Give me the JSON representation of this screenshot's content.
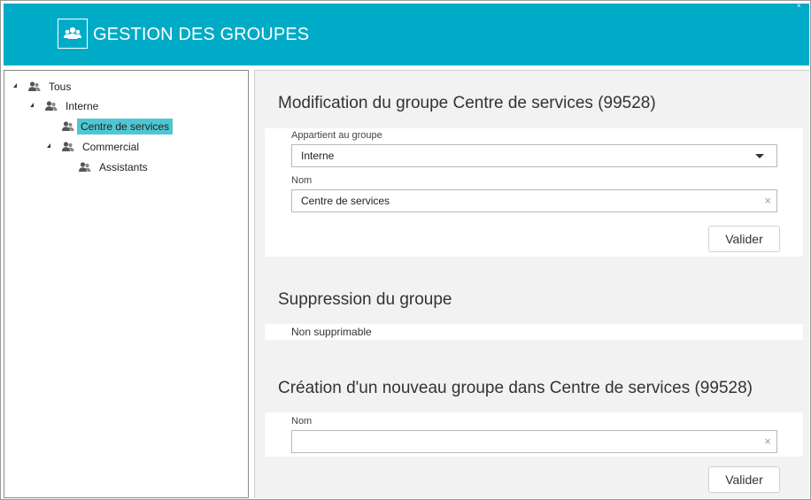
{
  "header": {
    "title": "GESTION DES GROUPES",
    "logo_icon": "group-icon",
    "close_glyph": "×",
    "background": "#00abc7"
  },
  "tree": {
    "items": [
      {
        "label": "Tous",
        "level": 0,
        "expanded": true
      },
      {
        "label": "Interne",
        "level": 1,
        "expanded": true
      },
      {
        "label": "Centre de services",
        "level": 2,
        "selected": true
      },
      {
        "label": "Commercial",
        "level": 2,
        "expanded": true
      },
      {
        "label": "Assistants",
        "level": 3
      }
    ],
    "selected_color": "#4fc6d3"
  },
  "modification": {
    "title": "Modification du groupe Centre de services (99528)",
    "parent_label": "Appartient au groupe",
    "parent_value": "Interne",
    "name_label": "Nom",
    "name_value": "Centre de services",
    "submit_label": "Valider"
  },
  "suppression": {
    "title": "Suppression du groupe",
    "status": "Non supprimable"
  },
  "creation": {
    "title": "Création d'un nouveau groupe dans Centre de services (99528)",
    "name_label": "Nom",
    "name_value": "",
    "submit_label": "Valider"
  },
  "clear_glyph": "×"
}
